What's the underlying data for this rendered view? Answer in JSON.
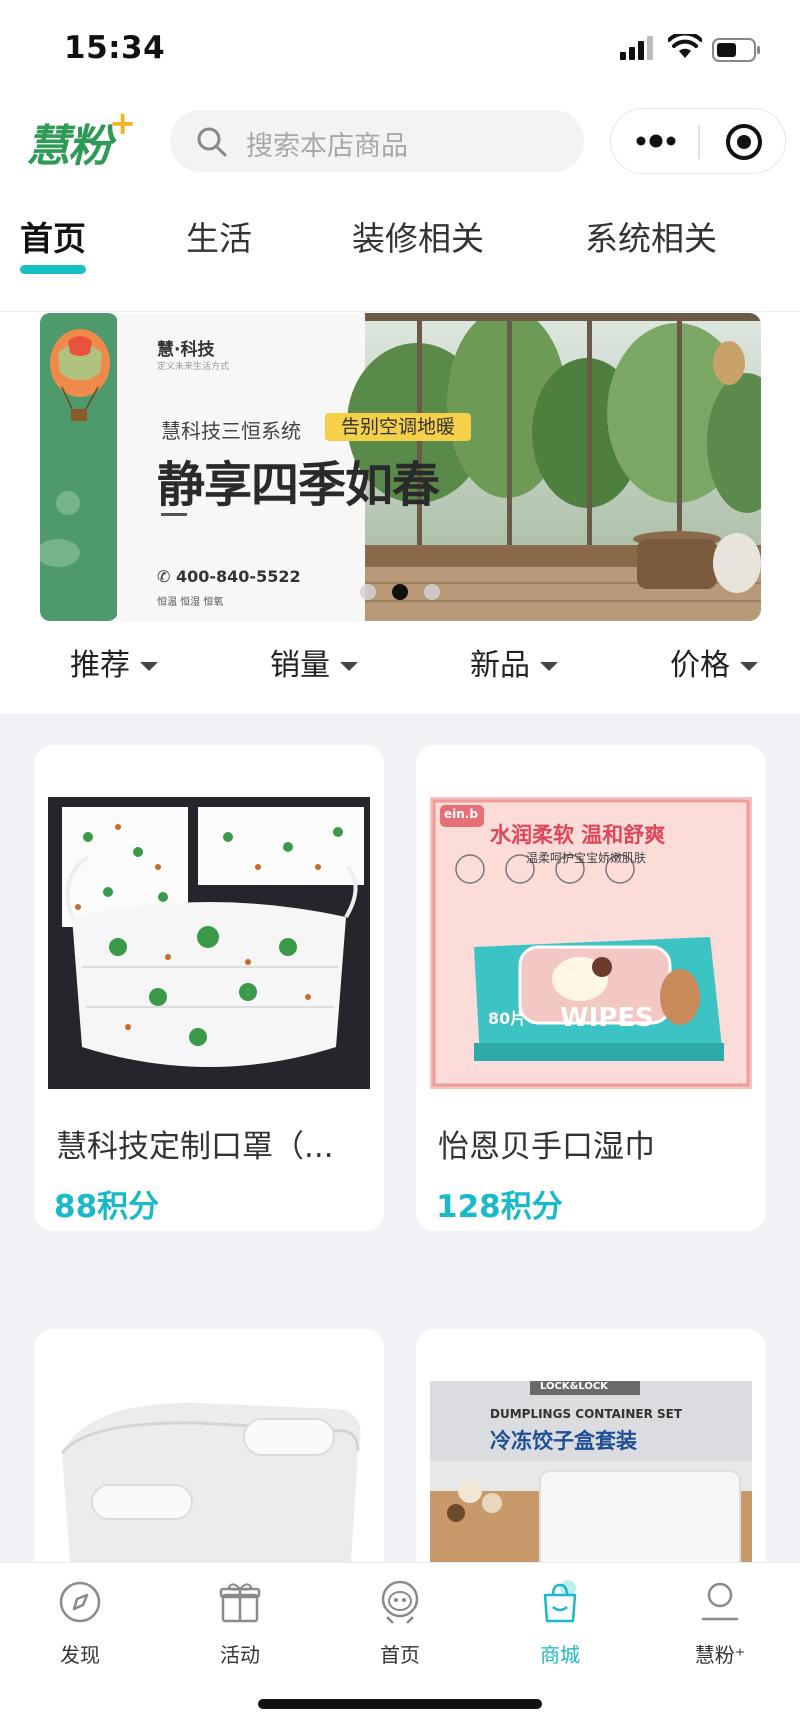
{
  "status_bar": {
    "time": "15:34"
  },
  "header": {
    "logo_text": "慧粉",
    "logo_plus": "+",
    "search_placeholder": "搜索本店商品"
  },
  "category_tabs": [
    {
      "label": "首页",
      "active": true
    },
    {
      "label": "生活",
      "active": false
    },
    {
      "label": "装修相关",
      "active": false
    },
    {
      "label": "系统相关",
      "active": false
    }
  ],
  "banner": {
    "brand": "慧·科技",
    "brand_sub": "定义未来生活方式",
    "system": "慧科技三恒系统",
    "tag": "告别空调地暖",
    "headline": "静享四季如春",
    "phone": "400-840-5522",
    "features": "恒温  恒湿  恒氧",
    "active_dot": 1,
    "dot_count": 3
  },
  "sort_options": [
    {
      "label": "推荐"
    },
    {
      "label": "销量"
    },
    {
      "label": "新品"
    },
    {
      "label": "价格"
    }
  ],
  "products": [
    {
      "name": "慧科技定制口罩（...",
      "price": "88积分",
      "image": "mask-product-image"
    },
    {
      "name": "怡恩贝手口湿巾",
      "price": "128积分",
      "image": "wipes-product-image"
    },
    {
      "name": "",
      "price": "",
      "image": "storage-box-product-image"
    },
    {
      "name": "",
      "price": "",
      "image": "dumpling-box-product-image"
    }
  ],
  "wipes_image_text": {
    "brand": "ein.b",
    "headline": "水润柔软 温和舒爽",
    "sub": "温柔呵护宝宝娇嫩肌肤",
    "count": "80片",
    "product": "WIPES"
  },
  "dumpling_image_text": {
    "brand": "LOCK&LOCK",
    "en": "DUMPLINGS CONTAINER SET",
    "cn": "冷冻饺子盒套装"
  },
  "bottom_nav": [
    {
      "label": "发现",
      "icon": "compass-icon",
      "active": false
    },
    {
      "label": "活动",
      "icon": "gift-icon",
      "active": false
    },
    {
      "label": "首页",
      "icon": "mascot-icon",
      "active": false
    },
    {
      "label": "商城",
      "icon": "shopping-bag-icon",
      "active": true
    },
    {
      "label": "慧粉⁺",
      "icon": "user-icon",
      "active": false
    }
  ],
  "colors": {
    "accent": "#1ab9c8",
    "brand_green": "#2e9a55",
    "page_bg": "#f1f2f6"
  }
}
